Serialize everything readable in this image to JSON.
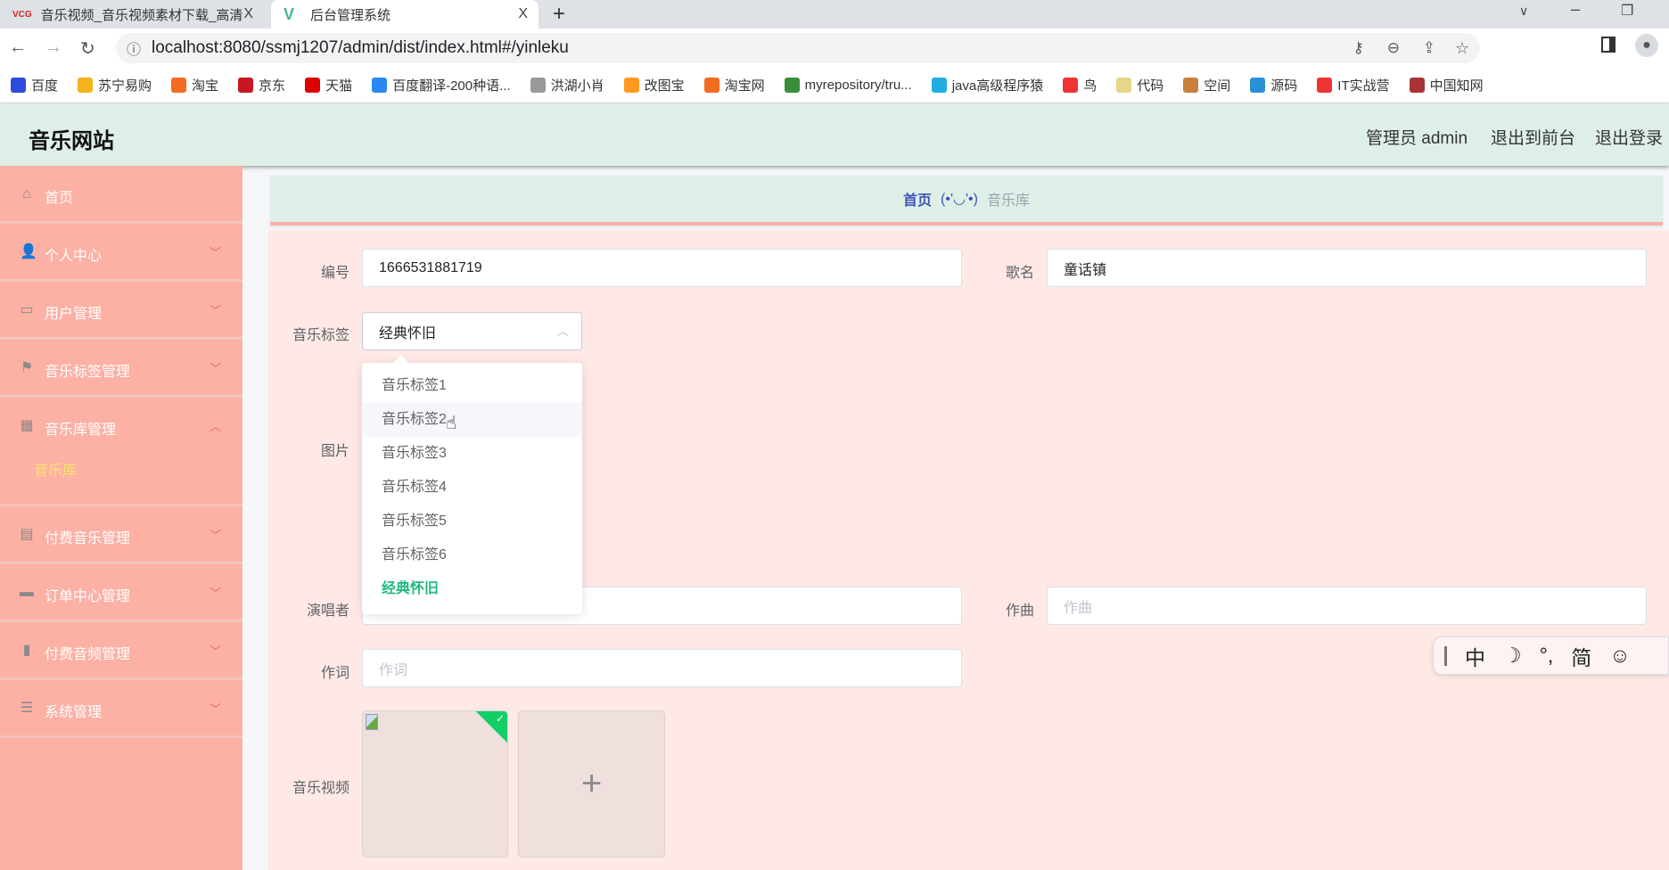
{
  "browser": {
    "tabs": [
      {
        "icon": "VCG",
        "title": "音乐视频_音乐视频素材下载_高清",
        "close": "X"
      },
      {
        "icon": "V",
        "title": "后台管理系统",
        "close": "X"
      }
    ],
    "new_tab": "+",
    "url": "localhost:8080/ssmj1207/admin/dist/index.html#/yinleku",
    "bookmarks": [
      {
        "label": "百度",
        "color": "#2b4bdc"
      },
      {
        "label": "苏宁易购",
        "color": "#f6b31d"
      },
      {
        "label": "淘宝",
        "color": "#f36c21"
      },
      {
        "label": "京东",
        "color": "#c81623"
      },
      {
        "label": "天猫",
        "color": "#d00"
      },
      {
        "label": "百度翻译-200种语...",
        "color": "#2a88f0"
      },
      {
        "label": "洪湖小肖",
        "color": "#999"
      },
      {
        "label": "改图宝",
        "color": "#ff9a1f"
      },
      {
        "label": "淘宝网",
        "color": "#f36c21"
      },
      {
        "label": "myrepository/tru...",
        "color": "#3a8d3a"
      },
      {
        "label": "java高级程序猿",
        "color": "#23ade5"
      },
      {
        "label": "鸟",
        "color": "#e33"
      },
      {
        "label": "代码",
        "color": "#e6d68a"
      },
      {
        "label": "空间",
        "color": "#c9803a"
      },
      {
        "label": "源码",
        "color": "#2b8fd6"
      },
      {
        "label": "IT实战营",
        "color": "#e33"
      },
      {
        "label": "中国知网",
        "color": "#a33"
      }
    ]
  },
  "header": {
    "title": "音乐网站",
    "user": "管理员 admin",
    "to_front": "退出到前台",
    "logout": "退出登录"
  },
  "sidebar": {
    "items": [
      {
        "label": "首页",
        "icon": "⌂"
      },
      {
        "label": "个人中心",
        "icon": "👤"
      },
      {
        "label": "用户管理",
        "icon": "▭"
      },
      {
        "label": "音乐标签管理",
        "icon": "⚑"
      },
      {
        "label": "音乐库管理",
        "icon": "▦",
        "sub": "音乐库"
      },
      {
        "label": "付费音乐管理",
        "icon": "▤"
      },
      {
        "label": "订单中心管理",
        "icon": "▬"
      },
      {
        "label": "付费音频管理",
        "icon": "▮"
      },
      {
        "label": "系统管理",
        "icon": "☰"
      }
    ]
  },
  "breadcrumb": {
    "home": "首页",
    "sep": "(•'◡'•)",
    "current": "音乐库"
  },
  "form": {
    "id_label": "编号",
    "id_value": "1666531881719",
    "name_label": "歌名",
    "name_value": "童话镇",
    "tag_label": "音乐标签",
    "tag_value": "经典怀旧",
    "tag_options": [
      "音乐标签1",
      "音乐标签2",
      "音乐标签3",
      "音乐标签4",
      "音乐标签5",
      "音乐标签6",
      "经典怀旧"
    ],
    "image_label": "图片",
    "singer_label": "演唱者",
    "composer_label": "作曲",
    "composer_placeholder": "作曲",
    "lyricist_label": "作词",
    "lyricist_placeholder": "作词",
    "video_label": "音乐视频"
  },
  "ime": {
    "mode": "中",
    "moon": "☽",
    "punct": "°,",
    "simp": "简",
    "emoji": "☺"
  }
}
